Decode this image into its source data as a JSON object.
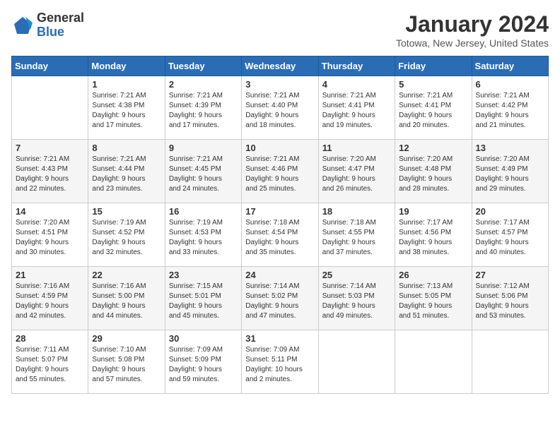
{
  "header": {
    "logo_general": "General",
    "logo_blue": "Blue",
    "title": "January 2024",
    "subtitle": "Totowa, New Jersey, United States"
  },
  "calendar": {
    "days_of_week": [
      "Sunday",
      "Monday",
      "Tuesday",
      "Wednesday",
      "Thursday",
      "Friday",
      "Saturday"
    ],
    "weeks": [
      [
        {
          "day": "",
          "info": ""
        },
        {
          "day": "1",
          "info": "Sunrise: 7:21 AM\nSunset: 4:38 PM\nDaylight: 9 hours\nand 17 minutes."
        },
        {
          "day": "2",
          "info": "Sunrise: 7:21 AM\nSunset: 4:39 PM\nDaylight: 9 hours\nand 17 minutes."
        },
        {
          "day": "3",
          "info": "Sunrise: 7:21 AM\nSunset: 4:40 PM\nDaylight: 9 hours\nand 18 minutes."
        },
        {
          "day": "4",
          "info": "Sunrise: 7:21 AM\nSunset: 4:41 PM\nDaylight: 9 hours\nand 19 minutes."
        },
        {
          "day": "5",
          "info": "Sunrise: 7:21 AM\nSunset: 4:41 PM\nDaylight: 9 hours\nand 20 minutes."
        },
        {
          "day": "6",
          "info": "Sunrise: 7:21 AM\nSunset: 4:42 PM\nDaylight: 9 hours\nand 21 minutes."
        }
      ],
      [
        {
          "day": "7",
          "info": "Sunrise: 7:21 AM\nSunset: 4:43 PM\nDaylight: 9 hours\nand 22 minutes."
        },
        {
          "day": "8",
          "info": "Sunrise: 7:21 AM\nSunset: 4:44 PM\nDaylight: 9 hours\nand 23 minutes."
        },
        {
          "day": "9",
          "info": "Sunrise: 7:21 AM\nSunset: 4:45 PM\nDaylight: 9 hours\nand 24 minutes."
        },
        {
          "day": "10",
          "info": "Sunrise: 7:21 AM\nSunset: 4:46 PM\nDaylight: 9 hours\nand 25 minutes."
        },
        {
          "day": "11",
          "info": "Sunrise: 7:20 AM\nSunset: 4:47 PM\nDaylight: 9 hours\nand 26 minutes."
        },
        {
          "day": "12",
          "info": "Sunrise: 7:20 AM\nSunset: 4:48 PM\nDaylight: 9 hours\nand 28 minutes."
        },
        {
          "day": "13",
          "info": "Sunrise: 7:20 AM\nSunset: 4:49 PM\nDaylight: 9 hours\nand 29 minutes."
        }
      ],
      [
        {
          "day": "14",
          "info": "Sunrise: 7:20 AM\nSunset: 4:51 PM\nDaylight: 9 hours\nand 30 minutes."
        },
        {
          "day": "15",
          "info": "Sunrise: 7:19 AM\nSunset: 4:52 PM\nDaylight: 9 hours\nand 32 minutes."
        },
        {
          "day": "16",
          "info": "Sunrise: 7:19 AM\nSunset: 4:53 PM\nDaylight: 9 hours\nand 33 minutes."
        },
        {
          "day": "17",
          "info": "Sunrise: 7:18 AM\nSunset: 4:54 PM\nDaylight: 9 hours\nand 35 minutes."
        },
        {
          "day": "18",
          "info": "Sunrise: 7:18 AM\nSunset: 4:55 PM\nDaylight: 9 hours\nand 37 minutes."
        },
        {
          "day": "19",
          "info": "Sunrise: 7:17 AM\nSunset: 4:56 PM\nDaylight: 9 hours\nand 38 minutes."
        },
        {
          "day": "20",
          "info": "Sunrise: 7:17 AM\nSunset: 4:57 PM\nDaylight: 9 hours\nand 40 minutes."
        }
      ],
      [
        {
          "day": "21",
          "info": "Sunrise: 7:16 AM\nSunset: 4:59 PM\nDaylight: 9 hours\nand 42 minutes."
        },
        {
          "day": "22",
          "info": "Sunrise: 7:16 AM\nSunset: 5:00 PM\nDaylight: 9 hours\nand 44 minutes."
        },
        {
          "day": "23",
          "info": "Sunrise: 7:15 AM\nSunset: 5:01 PM\nDaylight: 9 hours\nand 45 minutes."
        },
        {
          "day": "24",
          "info": "Sunrise: 7:14 AM\nSunset: 5:02 PM\nDaylight: 9 hours\nand 47 minutes."
        },
        {
          "day": "25",
          "info": "Sunrise: 7:14 AM\nSunset: 5:03 PM\nDaylight: 9 hours\nand 49 minutes."
        },
        {
          "day": "26",
          "info": "Sunrise: 7:13 AM\nSunset: 5:05 PM\nDaylight: 9 hours\nand 51 minutes."
        },
        {
          "day": "27",
          "info": "Sunrise: 7:12 AM\nSunset: 5:06 PM\nDaylight: 9 hours\nand 53 minutes."
        }
      ],
      [
        {
          "day": "28",
          "info": "Sunrise: 7:11 AM\nSunset: 5:07 PM\nDaylight: 9 hours\nand 55 minutes."
        },
        {
          "day": "29",
          "info": "Sunrise: 7:10 AM\nSunset: 5:08 PM\nDaylight: 9 hours\nand 57 minutes."
        },
        {
          "day": "30",
          "info": "Sunrise: 7:09 AM\nSunset: 5:09 PM\nDaylight: 9 hours\nand 59 minutes."
        },
        {
          "day": "31",
          "info": "Sunrise: 7:09 AM\nSunset: 5:11 PM\nDaylight: 10 hours\nand 2 minutes."
        },
        {
          "day": "",
          "info": ""
        },
        {
          "day": "",
          "info": ""
        },
        {
          "day": "",
          "info": ""
        }
      ]
    ]
  }
}
